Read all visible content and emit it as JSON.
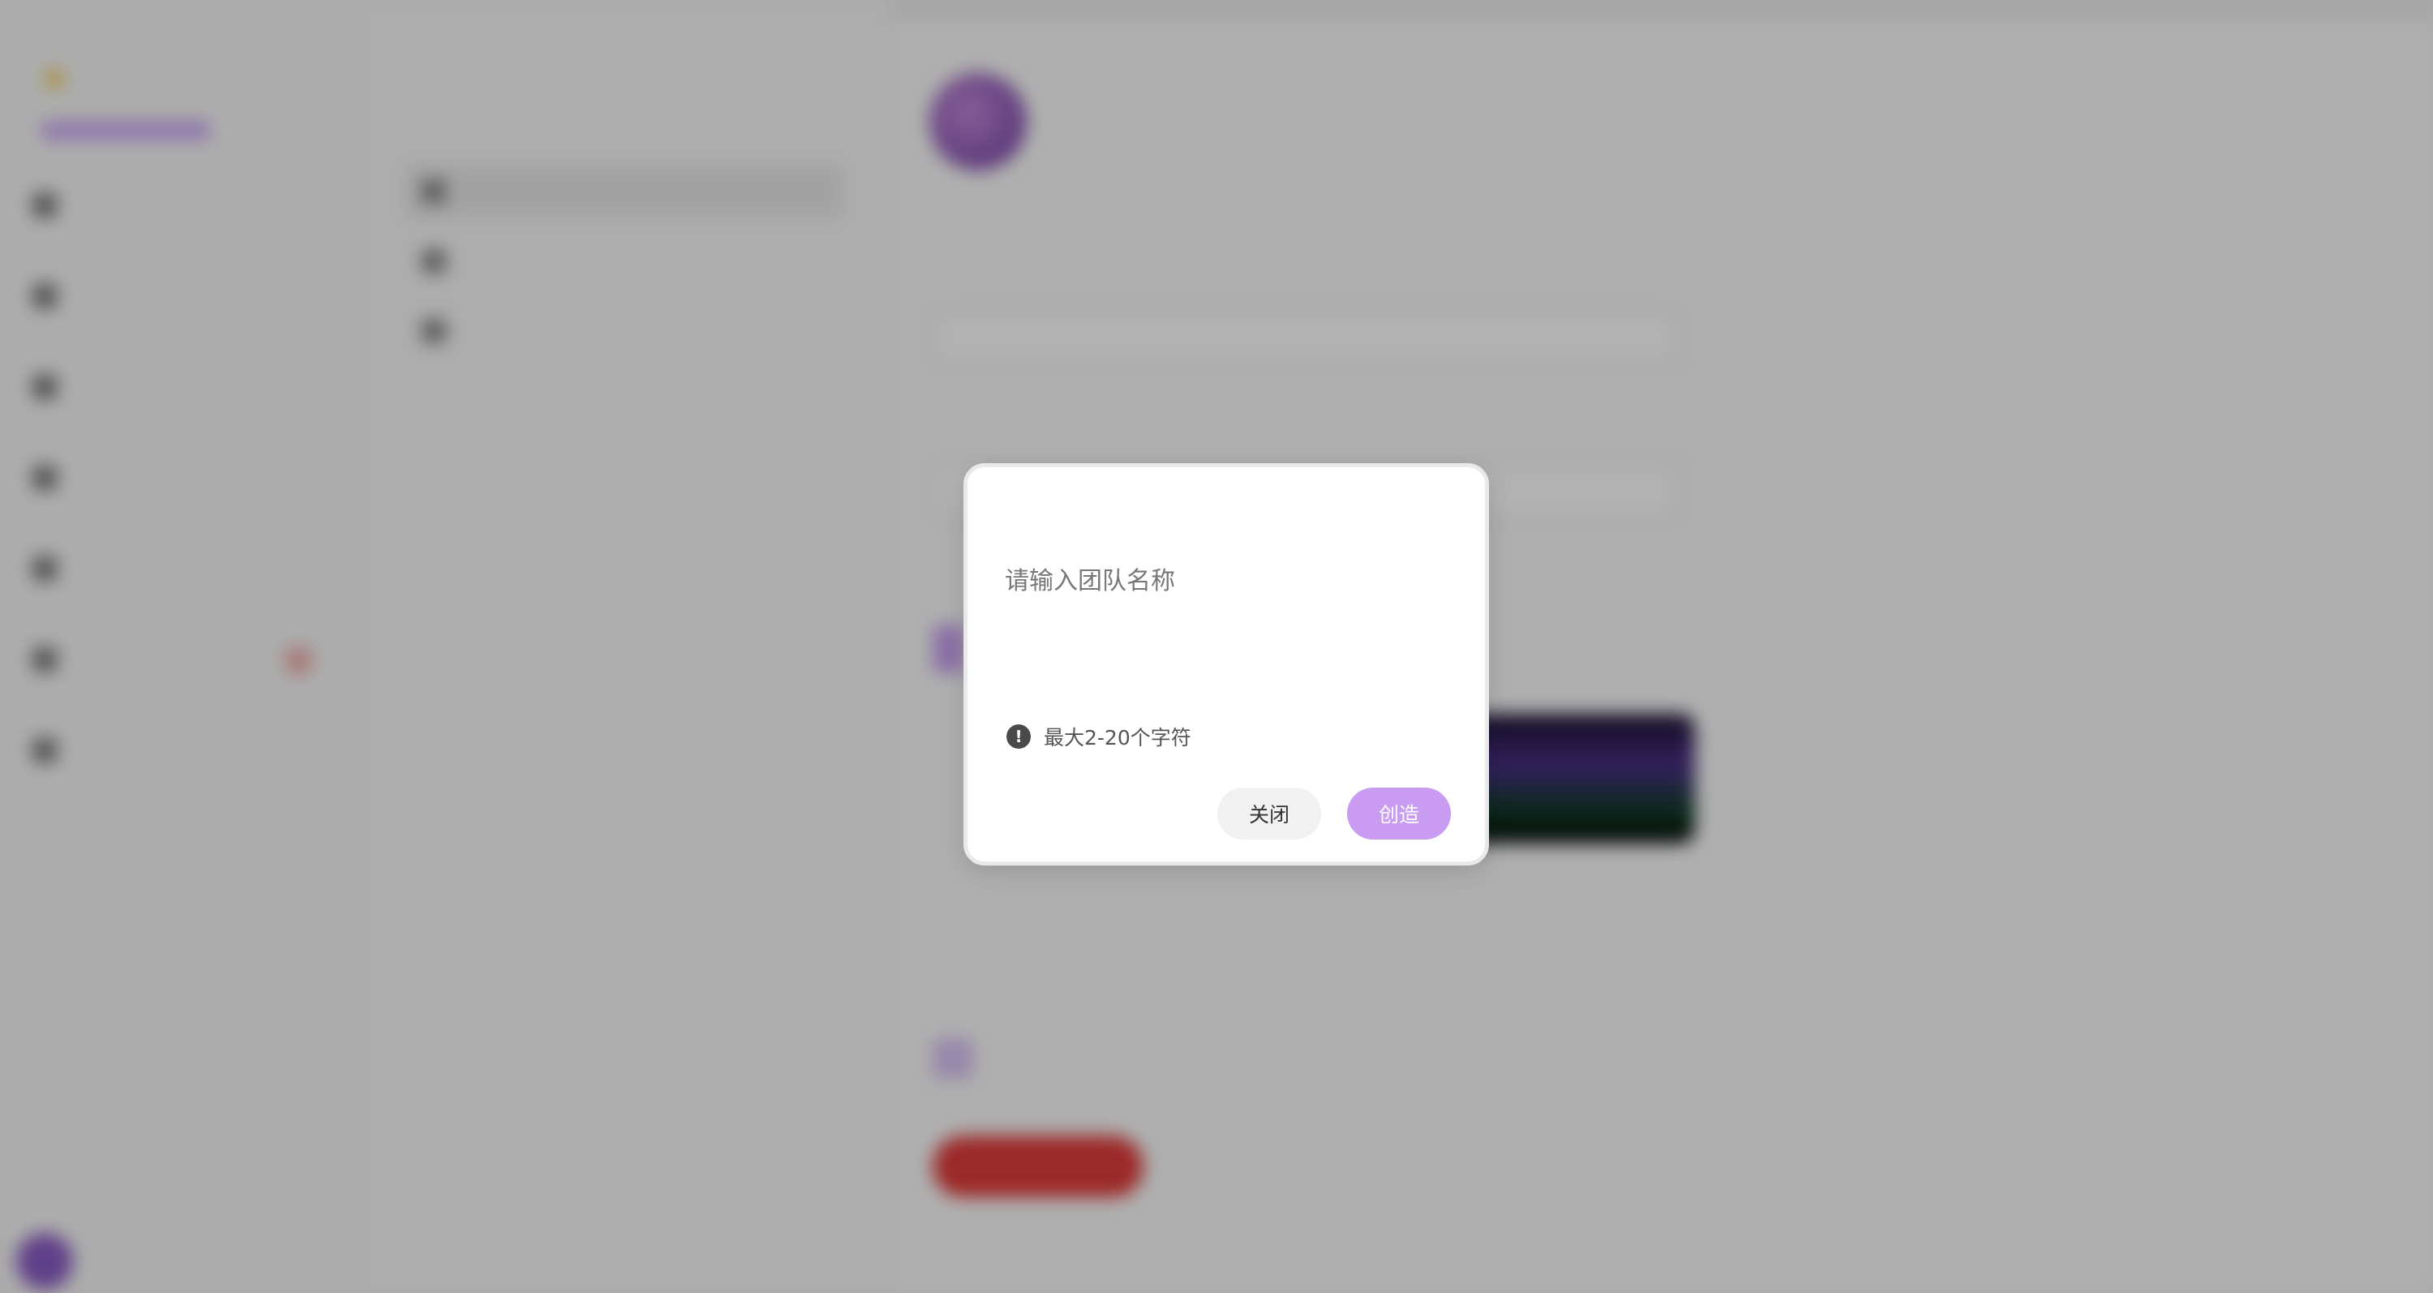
{
  "modal": {
    "input_placeholder": "请输入团队名称",
    "input_value": "",
    "hint_icon_glyph": "!",
    "hint_text": "最大2-20个字符",
    "close_label": "关闭",
    "create_label": "创造"
  },
  "colors": {
    "accent": "#c99cf1",
    "overlay": "rgba(0,0,0,0.30)",
    "danger": "#e03b3b"
  }
}
